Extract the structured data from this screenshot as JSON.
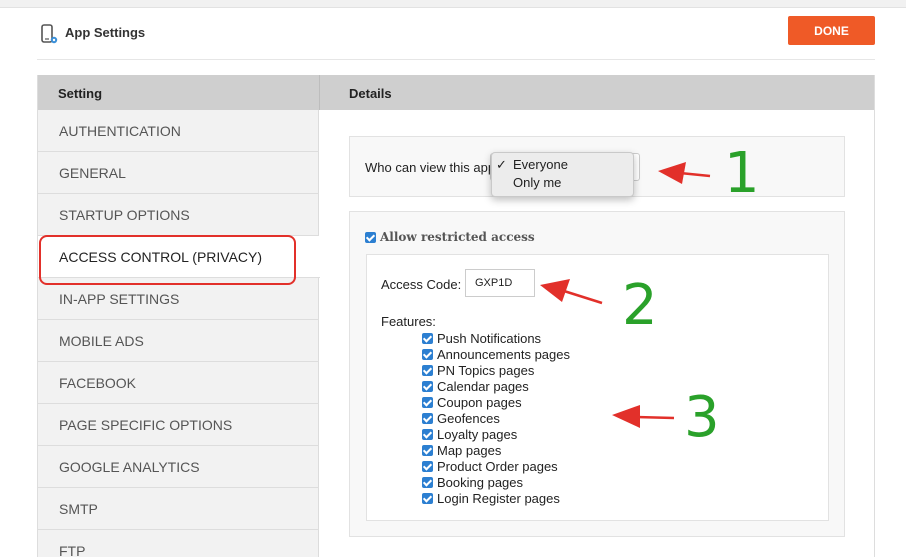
{
  "header": {
    "title": "App Settings",
    "done_label": "DONE",
    "icon": "phone-settings-icon"
  },
  "table": {
    "col_setting": "Setting",
    "col_details": "Details"
  },
  "sidebar": {
    "items": [
      {
        "label": "AUTHENTICATION"
      },
      {
        "label": "GENERAL"
      },
      {
        "label": "STARTUP OPTIONS"
      },
      {
        "label": "ACCESS CONTROL (PRIVACY)",
        "active": true
      },
      {
        "label": "IN-APP SETTINGS"
      },
      {
        "label": "MOBILE ADS"
      },
      {
        "label": "FACEBOOK"
      },
      {
        "label": "PAGE SPECIFIC OPTIONS"
      },
      {
        "label": "GOOGLE ANALYTICS"
      },
      {
        "label": "SMTP"
      },
      {
        "label": "FTP"
      }
    ]
  },
  "privacy": {
    "who_label": "Who can view this app",
    "options": [
      "Everyone",
      "Only me"
    ],
    "selected": "Everyone",
    "check_glyph": "✓"
  },
  "restricted": {
    "allow_label": "Allow restricted access",
    "allow_checked": true,
    "code_label": "Access Code:",
    "code_value": "GXP1D",
    "features_label": "Features:",
    "features": [
      "Push Notifications",
      "Announcements pages",
      "PN Topics pages",
      "Calendar pages",
      "Coupon pages",
      "Geofences",
      "Loyalty pages",
      "Map pages",
      "Product Order pages",
      "Booking pages",
      "Login Register pages"
    ]
  },
  "annotations": {
    "numbers": [
      "1",
      "2",
      "3"
    ],
    "arrow_color": "#e2302a",
    "number_color": "#2aa12a"
  },
  "colors": {
    "accent": "#ef5a27",
    "checkbox": "#2c7fd1"
  }
}
